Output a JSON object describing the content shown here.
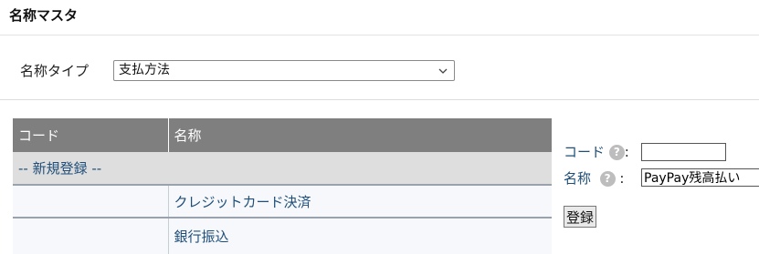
{
  "page": {
    "title": "名称マスタ"
  },
  "type_select": {
    "label": "名称タイプ",
    "value": "支払方法"
  },
  "table": {
    "headers": {
      "code": "コード",
      "name": "名称"
    },
    "new_entry": "-- 新規登録 --",
    "rows": [
      {
        "code": "",
        "name": "クレジットカード決済"
      },
      {
        "code": "",
        "name": "銀行振込"
      }
    ]
  },
  "form": {
    "code_label": "コード",
    "name_label": "名称",
    "help_glyph": "?",
    "colon": ":",
    "code_value": "",
    "name_value": "PayPay残高払い",
    "submit_label": "登録"
  },
  "colors": {
    "header_bg": "#7f7f7f",
    "link": "#1f4e79"
  }
}
